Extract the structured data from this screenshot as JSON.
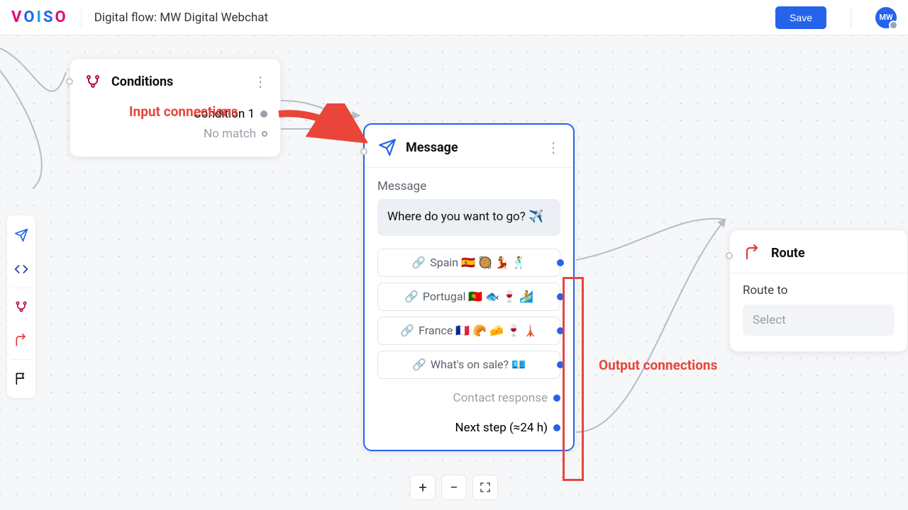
{
  "header": {
    "logo_letters": [
      "V",
      "O",
      "I",
      "S",
      "O"
    ],
    "page_title": "Digital flow: MW Digital Webchat",
    "save_label": "Save",
    "avatar_initials": "MW"
  },
  "toolbar_icons": [
    "message",
    "code",
    "conditions",
    "route",
    "flag"
  ],
  "conditions_card": {
    "title": "Conditions",
    "rows": [
      {
        "label": "Condition 1",
        "muted": false,
        "port": "solid"
      },
      {
        "label": "No match",
        "muted": true,
        "port": "hollow"
      }
    ]
  },
  "message_card": {
    "title": "Message",
    "field_label": "Message",
    "bubble_text": "Where do you want to go? ✈️",
    "options": [
      "Spain 🇪🇸 🥘 💃 🕺",
      "Portugal 🇵🇹 🐟 🍷 🏄",
      "France 🇫🇷 🥐 🧀 🍷 🗼",
      "What's on sale? 💶"
    ],
    "extra": [
      {
        "label": "Contact response",
        "muted": true
      },
      {
        "label": "Next step (≈24 h)",
        "muted": false
      }
    ]
  },
  "route_card": {
    "title": "Route",
    "field_label": "Route to",
    "select_placeholder": "Select"
  },
  "annotations": {
    "input": "Input connections",
    "output": "Output connections"
  },
  "zoom": {
    "in": "+",
    "out": "−"
  },
  "colors": {
    "accent": "#2563eb",
    "danger": "#e9453b",
    "brand_pink": "#e6007e"
  }
}
